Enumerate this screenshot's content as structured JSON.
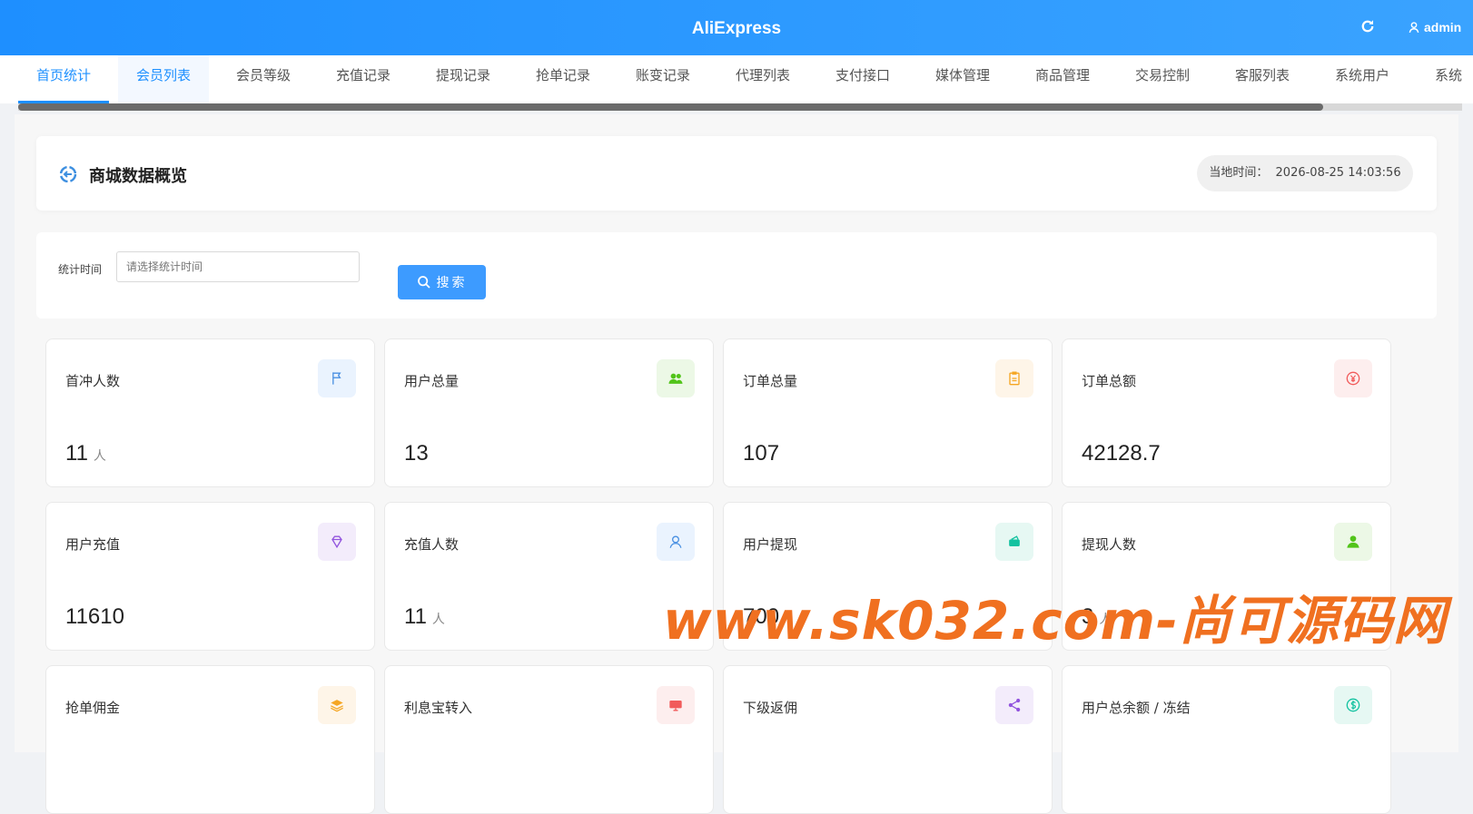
{
  "header": {
    "brand": "AliExpress",
    "user": "admin"
  },
  "nav": {
    "tabs": [
      {
        "label": "首页统计",
        "state": "active"
      },
      {
        "label": "会员列表",
        "state": "hover"
      },
      {
        "label": "会员等级"
      },
      {
        "label": "充值记录"
      },
      {
        "label": "提现记录"
      },
      {
        "label": "抢单记录"
      },
      {
        "label": "账变记录"
      },
      {
        "label": "代理列表"
      },
      {
        "label": "支付接口"
      },
      {
        "label": "媒体管理"
      },
      {
        "label": "商品管理"
      },
      {
        "label": "交易控制"
      },
      {
        "label": "客服列表"
      },
      {
        "label": "系统用户"
      },
      {
        "label": "系统"
      }
    ]
  },
  "overview": {
    "title": "商城数据概览",
    "time_label": "当地时间：",
    "time_value": "2026-08-25 14:03:56"
  },
  "search": {
    "label": "统计时间",
    "placeholder": "请选择统计时间",
    "button": "搜索"
  },
  "cards": [
    {
      "label": "首冲人数",
      "value": "11",
      "unit": "人",
      "icon": "flag-icon",
      "color": "#4a90e2",
      "bg": "#eaf3fe"
    },
    {
      "label": "用户总量",
      "value": "13",
      "unit": "",
      "icon": "users-icon",
      "color": "#52c41a",
      "bg": "#ecf8e6"
    },
    {
      "label": "订单总量",
      "value": "107",
      "unit": "",
      "icon": "clipboard-icon",
      "color": "#f5a623",
      "bg": "#fef5e8"
    },
    {
      "label": "订单总额",
      "value": "42128.7",
      "unit": "",
      "icon": "yen-icon",
      "color": "#f15b5b",
      "bg": "#fdeeee"
    },
    {
      "label": "用户充值",
      "value": "11610",
      "unit": "",
      "icon": "diamond-icon",
      "color": "#9254de",
      "bg": "#f3ecfb"
    },
    {
      "label": "充值人数",
      "value": "11",
      "unit": "人",
      "icon": "user-outline-icon",
      "color": "#4a90e2",
      "bg": "#eaf3fe"
    },
    {
      "label": "用户提现",
      "value": "700",
      "unit": "",
      "icon": "wallet-icon",
      "color": "#13c2a0",
      "bg": "#e6f8f3"
    },
    {
      "label": "提现人数",
      "value": "3",
      "unit": "人",
      "icon": "user-icon",
      "color": "#52c41a",
      "bg": "#ecf8e6"
    },
    {
      "label": "抢单佣金",
      "value": "",
      "unit": "",
      "icon": "layers-icon",
      "color": "#f5a623",
      "bg": "#fef5e8"
    },
    {
      "label": "利息宝转入",
      "value": "",
      "unit": "",
      "icon": "monitor-icon",
      "color": "#f15b5b",
      "bg": "#fdeeee"
    },
    {
      "label": "下级返佣",
      "value": "",
      "unit": "",
      "icon": "share-icon",
      "color": "#9254de",
      "bg": "#f3ecfb"
    },
    {
      "label": "用户总余额 / 冻结",
      "value": "",
      "unit": "",
      "icon": "dollar-icon",
      "color": "#13c2a0",
      "bg": "#e6f8f3"
    }
  ],
  "watermark": "www.sk032.com-尚可源码网"
}
